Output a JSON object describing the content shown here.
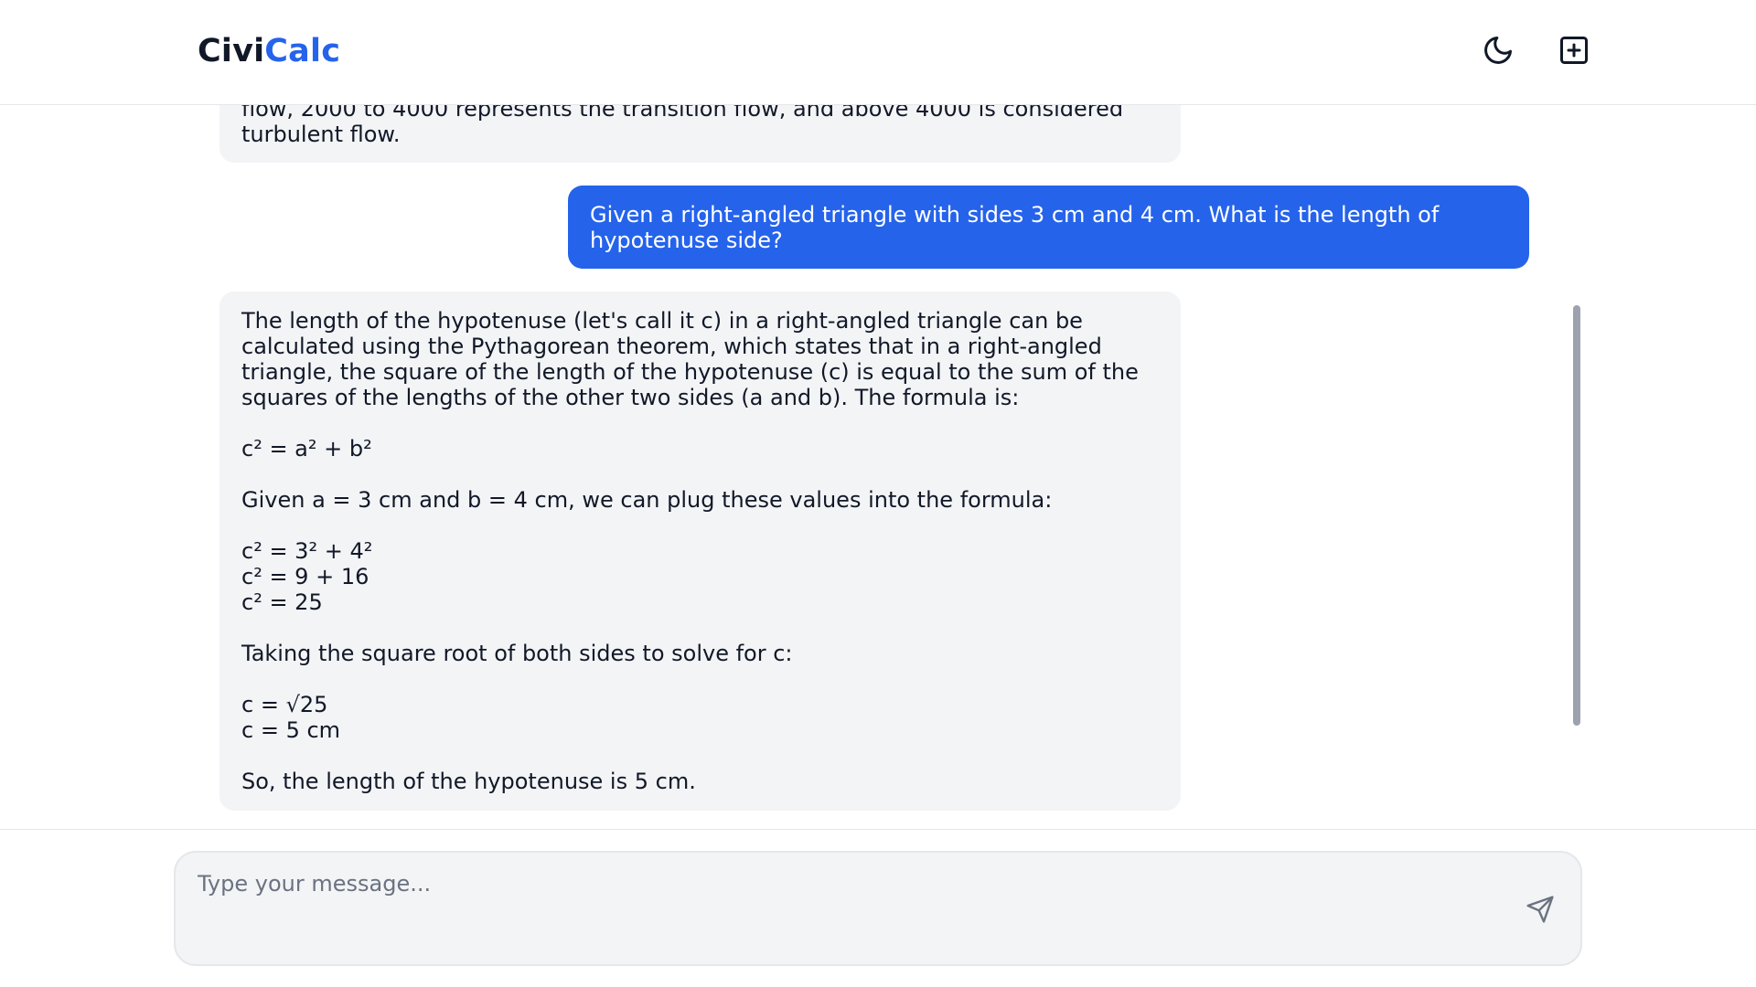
{
  "header": {
    "logo_part1": "Civi",
    "logo_part2": "Calc",
    "theme_icon": "moon-icon",
    "new_chat_icon": "plus-square-icon"
  },
  "messages": [
    {
      "role": "assistant",
      "text": "flow, 2000 to 4000 represents the transition flow, and above 4000 is considered\nturbulent flow."
    },
    {
      "role": "user",
      "text": "Given a right-angled triangle with sides 3 cm and 4 cm. What is the length of hypotenuse side?"
    },
    {
      "role": "assistant",
      "text": "The length of the hypotenuse (let's call it c) in a right-angled triangle can be calculated using the Pythagorean theorem, which states that in a right-angled triangle, the square of the length of the hypotenuse (c) is equal to the sum of the squares of the lengths of the other two sides (a and b). The formula is:\n\nc² = a² + b²\n\nGiven a = 3 cm and b = 4 cm, we can plug these values into the formula:\n\nc² = 3² + 4²\nc² = 9 + 16\nc² = 25\n\nTaking the square root of both sides to solve for c:\n\nc = √25\nc = 5 cm\n\nSo, the length of the hypotenuse is 5 cm."
    }
  ],
  "composer": {
    "placeholder": "Type your message...",
    "value": "",
    "send_icon": "send-icon"
  },
  "colors": {
    "accent": "#2563eb",
    "bubble_bg": "#f3f4f6",
    "text": "#111827"
  }
}
